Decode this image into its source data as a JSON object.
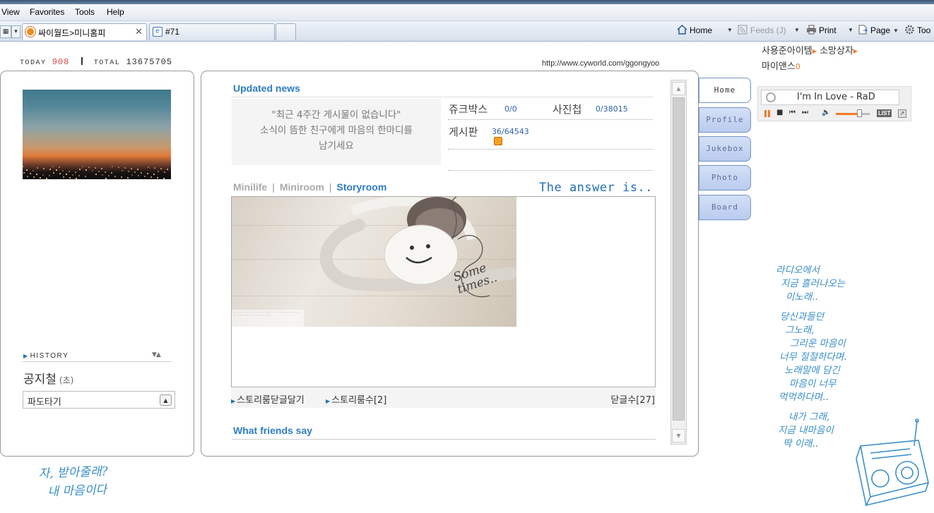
{
  "browser": {
    "menu": [
      "View",
      "Favorites",
      "Tools",
      "Help"
    ],
    "tabs": [
      {
        "label": "싸이월드>미니홈피",
        "active": true
      },
      {
        "label": "#71",
        "active": false
      }
    ],
    "toolbar": {
      "home": "Home",
      "feeds": "Feeds (J)",
      "print": "Print",
      "page": "Page",
      "tools": "Too"
    }
  },
  "counter": {
    "today_label": "TODAY",
    "today_value": "908",
    "total_label": "TOTAL",
    "total_value": "13675705"
  },
  "url": "http://www.cyworld.com/ggongyoo",
  "left": {
    "history_label": "HISTORY",
    "mood_title": "공지철",
    "mood_icon": "(초)",
    "mood_value": "파도타기"
  },
  "main": {
    "updated_news_title": "Updated news",
    "news_lines": [
      "\"최근 4주간 게시물이 없습니다\"",
      "소식이 뜸한 친구에게 마음의 한마디를",
      "남기세요"
    ],
    "stats": {
      "jukebox_label": "쥬크박스",
      "jukebox_value": "0/0",
      "photo_label": "사진첩",
      "photo_value": "0/38015",
      "board_label": "게시판",
      "board_value": "36/64543"
    },
    "tabs": {
      "minilife": "Minilife",
      "miniroom": "Miniroom",
      "storyroom": "Storyroom"
    },
    "answer": "The answer is..",
    "storyroom_image_text": "Some times..",
    "storyroom_footer": {
      "close_comments": "스토리룸닫글달기",
      "story_count": "스토리룸수[2]",
      "comment_count": "닫글수[27]"
    },
    "friends_title": "What friends say"
  },
  "side_tabs": [
    "Home",
    "Profile",
    "Jukebox",
    "Photo",
    "Board"
  ],
  "right": {
    "line1": "사용준아이템",
    "line1b": "소망상자",
    "line2": "마이앤스",
    "line2_count": "0",
    "now_playing": "I'm In Love - RaD",
    "list_label": "LIST"
  },
  "handwriting": {
    "right_block": [
      "라디오에서",
      "지금 흘러나오는",
      "이노래..",
      "",
      "당신과들던",
      "그노래,",
      "그리운 마음이",
      "너무 절절하다며.",
      "노래말에 담긴",
      "마음이 너무",
      "먹먹하다며..",
      "",
      "내가 그래,",
      "지금 내마음이",
      "딱 이래.."
    ],
    "bottom_block": [
      "자, 받아줄래?",
      "내 마음이다"
    ]
  },
  "colors": {
    "accent_blue": "#2e7cc4",
    "counter_red": "#e04949",
    "orange": "#f07a2a",
    "handwriting": "#3a8fc9"
  }
}
